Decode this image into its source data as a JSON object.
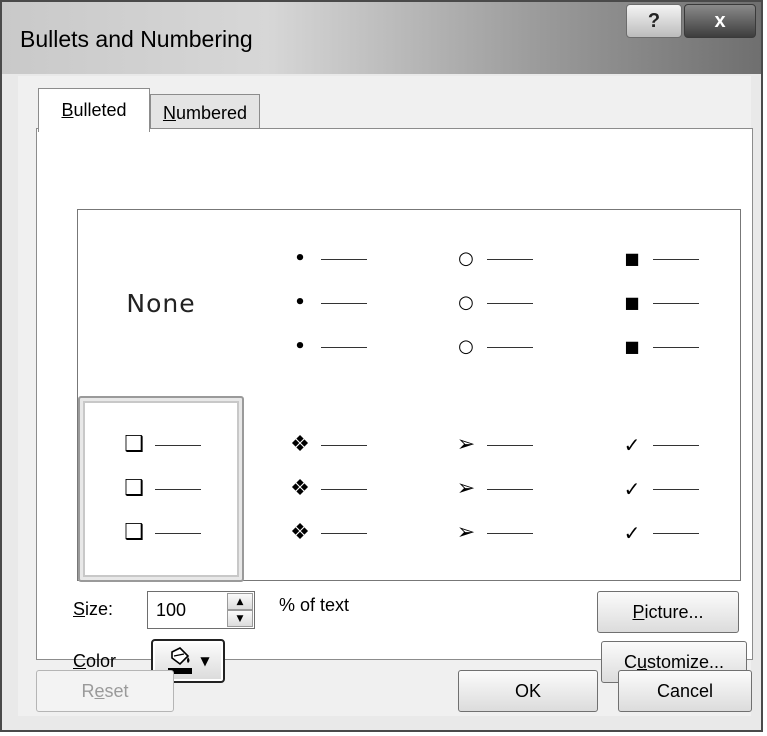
{
  "window": {
    "title": "Bullets and Numbering",
    "help_label": "?",
    "close_label": "x"
  },
  "tabs": [
    {
      "pre": "",
      "key": "B",
      "post": "ulleted",
      "active": true
    },
    {
      "pre": "",
      "key": "N",
      "post": "umbered",
      "active": false
    }
  ],
  "gallery": {
    "none_label": "None",
    "selected_index": 4,
    "styles": [
      {
        "name": "none",
        "glyph": ""
      },
      {
        "name": "filled-dot",
        "glyph": "•"
      },
      {
        "name": "hollow-circle",
        "glyph": "○"
      },
      {
        "name": "filled-square",
        "glyph": "■"
      },
      {
        "name": "hollow-square",
        "glyph": "❑"
      },
      {
        "name": "four-diamond",
        "glyph": "❖"
      },
      {
        "name": "arrowhead",
        "glyph": "➢"
      },
      {
        "name": "checkmark",
        "glyph": "✓"
      }
    ]
  },
  "size": {
    "pre": "",
    "key": "S",
    "post": "ize:",
    "value": "100",
    "unit": "% of text"
  },
  "color": {
    "pre": "",
    "key": "C",
    "post": "olor",
    "swatch": "#000000"
  },
  "buttons": {
    "picture": {
      "pre": "",
      "key": "P",
      "post": "icture..."
    },
    "customize": {
      "pre": "C",
      "key": "u",
      "post": "stomize..."
    },
    "reset": {
      "pre": "R",
      "key": "e",
      "post": "set"
    },
    "ok": "OK",
    "cancel": "Cancel"
  }
}
